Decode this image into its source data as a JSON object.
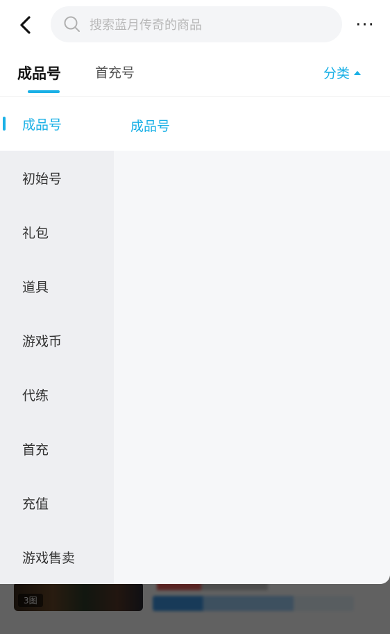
{
  "header": {
    "search_placeholder": "搜索蓝月传奇的商品",
    "more_label": "···"
  },
  "tabs": [
    {
      "label": "成品号",
      "active": true
    },
    {
      "label": "首充号",
      "active": false
    }
  ],
  "category_toggle": {
    "label": "分类"
  },
  "sidebar": {
    "items": [
      {
        "label": "成品号",
        "active": true
      },
      {
        "label": "初始号",
        "active": false
      },
      {
        "label": "礼包",
        "active": false
      },
      {
        "label": "道具",
        "active": false
      },
      {
        "label": "游戏币",
        "active": false
      },
      {
        "label": "代练",
        "active": false
      },
      {
        "label": "首充",
        "active": false
      },
      {
        "label": "充值",
        "active": false
      },
      {
        "label": "游戏售卖",
        "active": false
      }
    ]
  },
  "subcategory": {
    "items": [
      {
        "label": "成品号"
      }
    ]
  },
  "background_listing": {
    "image_count_label": "3图"
  },
  "colors": {
    "accent": "#1ab0e6",
    "overlay": "rgba(0,0,0,0.62)"
  },
  "icons": {
    "back": "chevron-left-icon",
    "search": "search-icon",
    "more": "more-dots-icon",
    "category_caret": "caret-up-icon"
  }
}
